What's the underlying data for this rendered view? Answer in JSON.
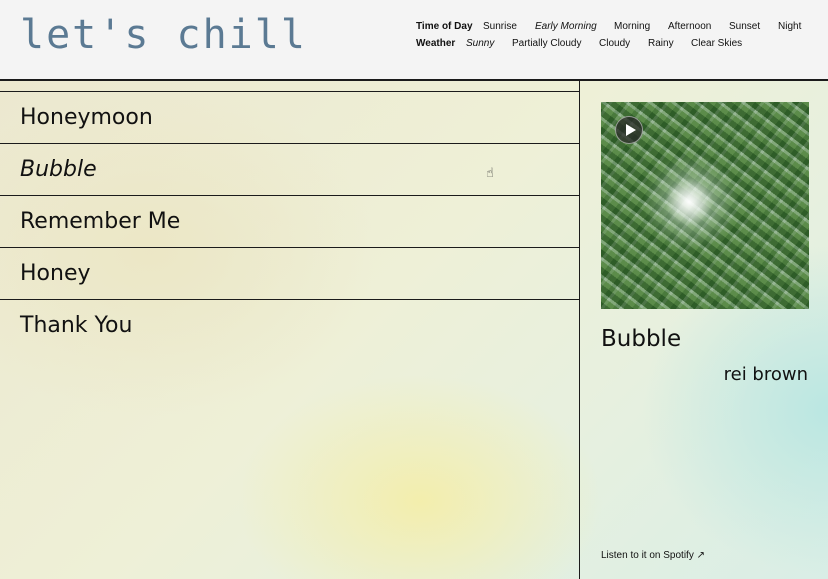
{
  "app": {
    "logo": "let's chill"
  },
  "filters": {
    "time_of_day": {
      "title": "Time of Day",
      "options": [
        "Sunrise",
        "Early Morning",
        "Morning",
        "Afternoon",
        "Sunset",
        "Night"
      ],
      "selected": "Early Morning"
    },
    "weather": {
      "title": "Weather",
      "options": [
        "Sunny",
        "Partially Cloudy",
        "Cloudy",
        "Rainy",
        "Clear Skies"
      ],
      "selected": "Sunny"
    }
  },
  "songs": [
    "Honeymoon",
    "Bubble",
    "Remember Me",
    "Honey",
    "Thank You"
  ],
  "active_song": "Bubble",
  "now_playing": {
    "title": "Bubble",
    "artist": "rei brown",
    "link_label": "Listen to it on Spotify ↗"
  },
  "icons": {
    "play": "play-icon",
    "cursor": "hand-pointer-icon"
  },
  "colors": {
    "logo": "#5b7a93",
    "border": "#1b1b1b"
  }
}
